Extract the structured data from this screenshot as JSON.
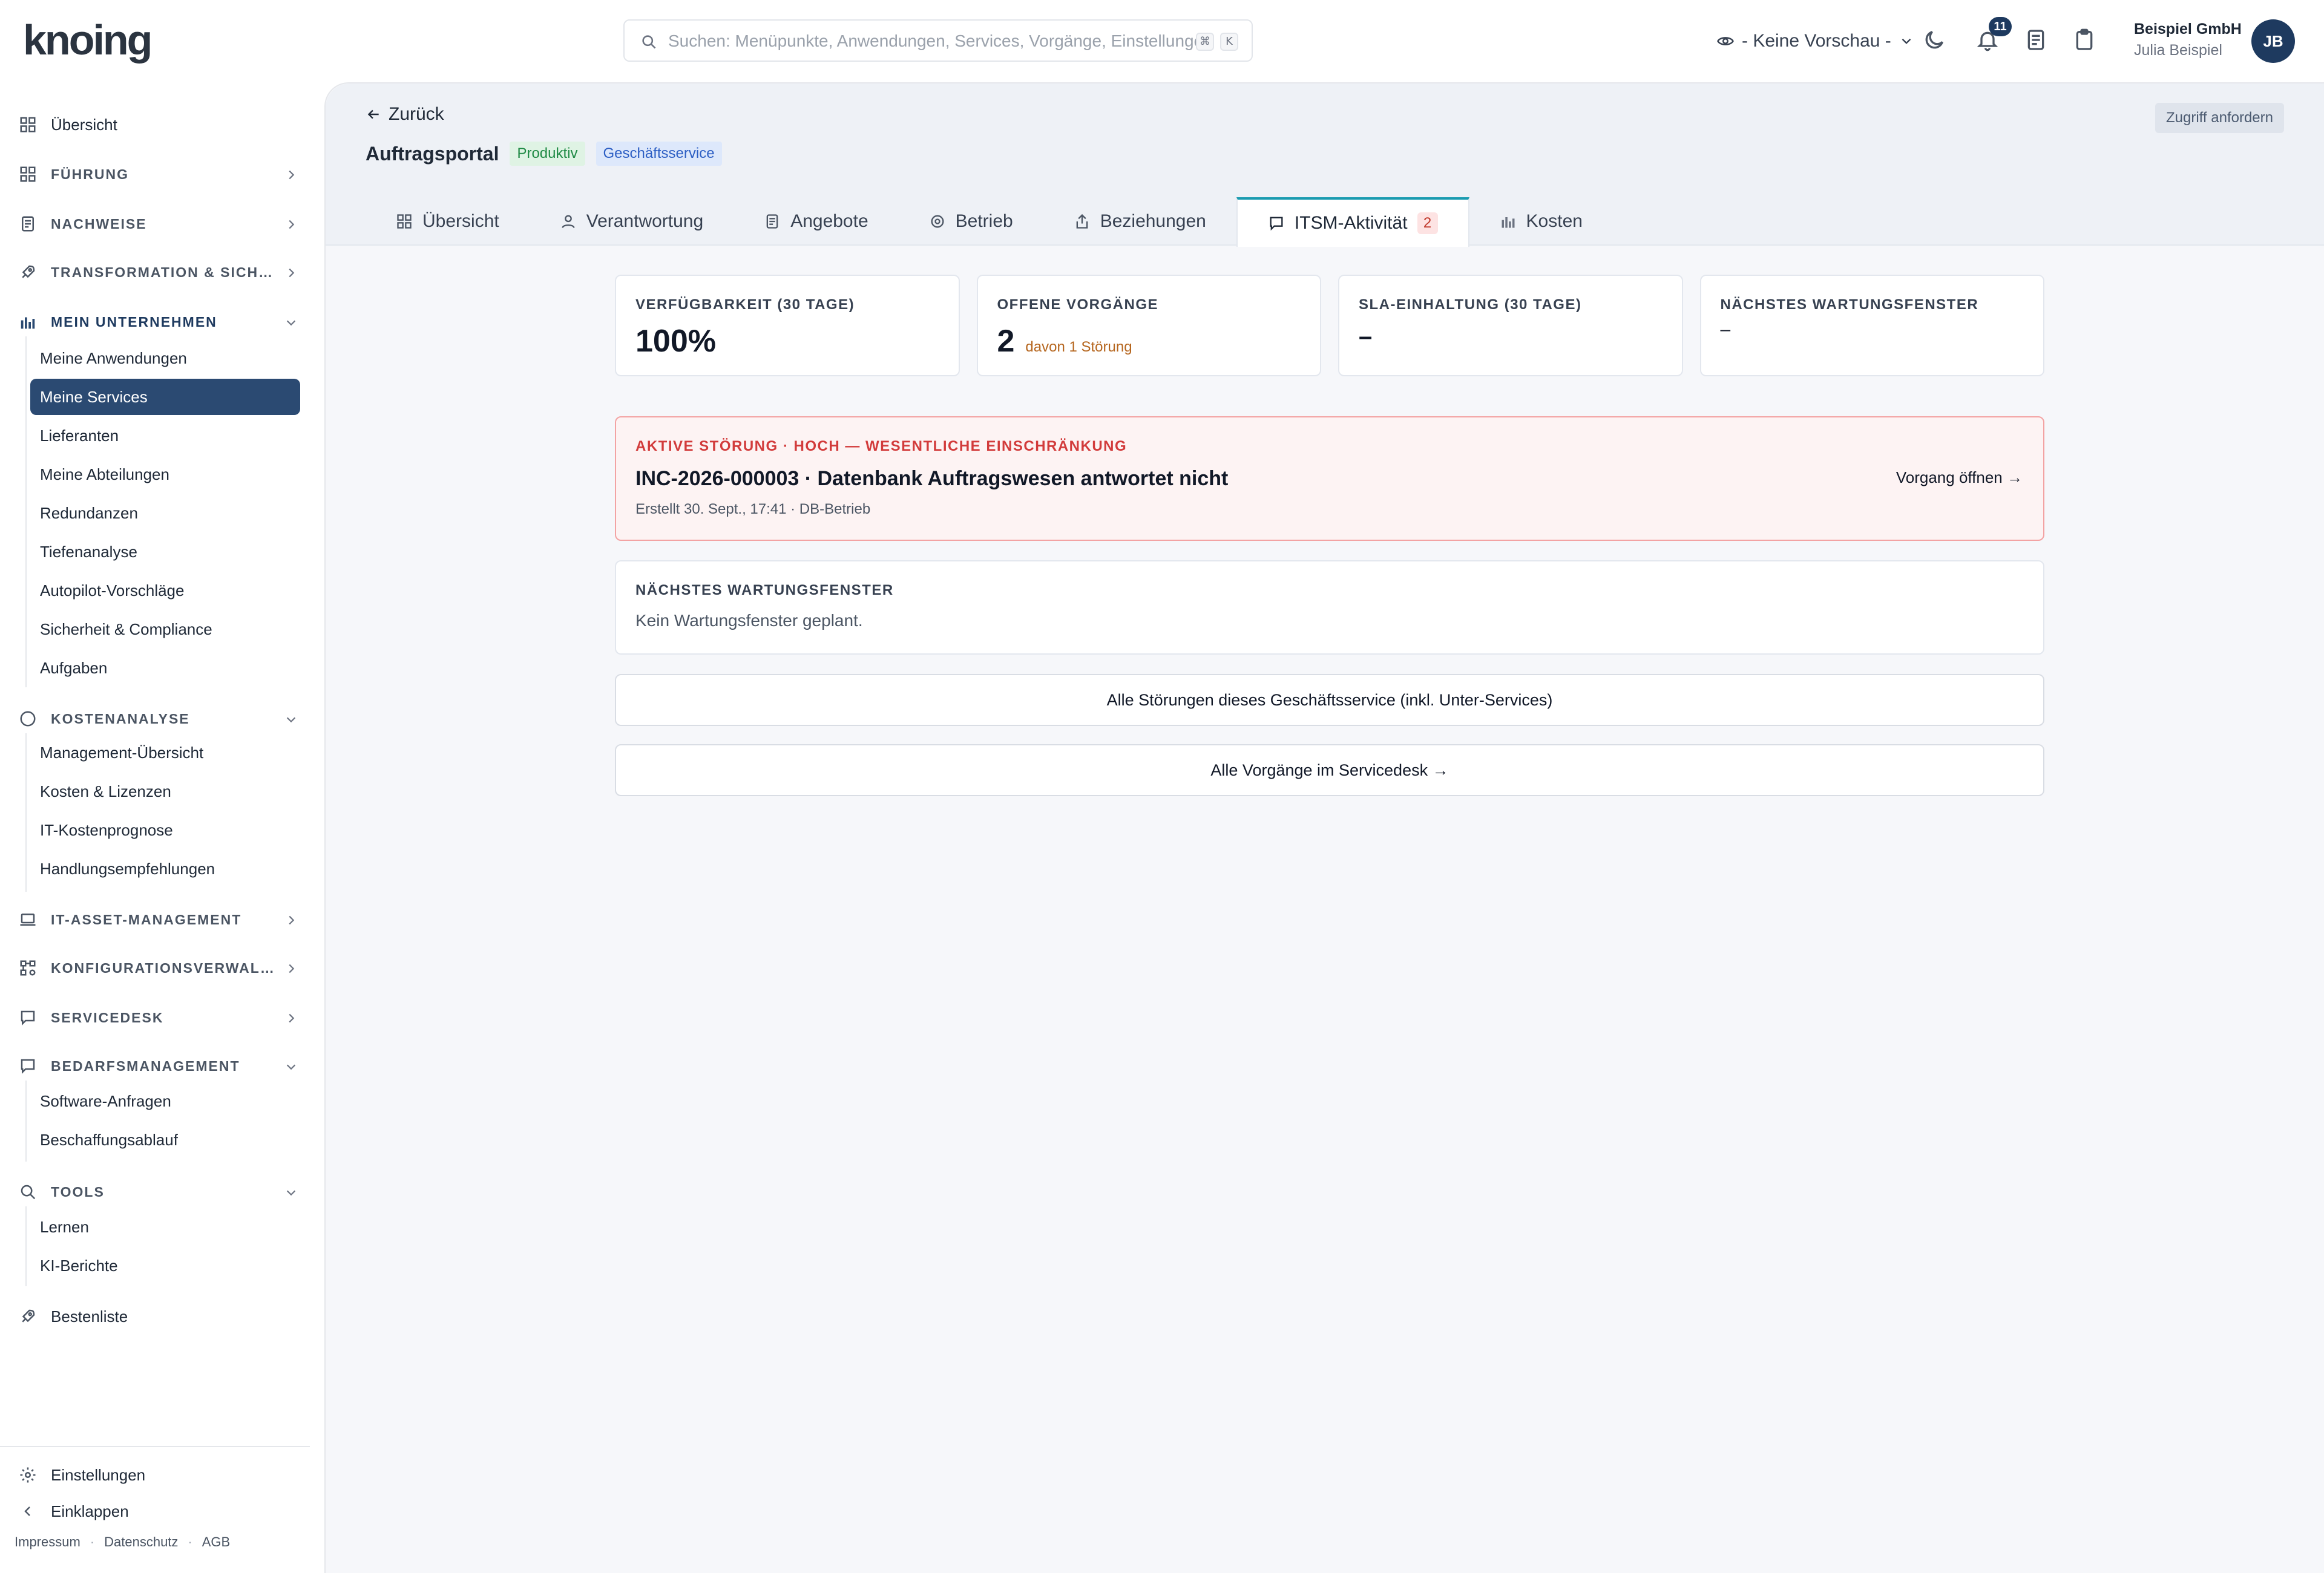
{
  "app": {
    "logo": "knoing",
    "search_placeholder": "Suchen: Menüpunkte, Anwendungen, Services, Vorgänge, Einstellungen",
    "shortcut_keys": [
      "⌘",
      "K"
    ],
    "preview_label": "- Keine Vorschau -",
    "notifications_count": "11",
    "org_name": "Beispiel GmbH",
    "user_name": "Julia Beispiel",
    "avatar_initials": "JB"
  },
  "sidebar": {
    "overview": "Übersicht",
    "sections": {
      "fuehrung": "Führung",
      "nachweise": "Nachweise",
      "transformation": "Transformation & Sich…",
      "mein_unternehmen": "Mein Unternehmen",
      "kostenanalyse": "Kostenanalyse",
      "itam": "IT-Asset-Management",
      "konfig": "Konfigurationsverwal…",
      "servicedesk": "Servicedesk",
      "bedarf": "Bedarfsmanagement",
      "tools": "Tools"
    },
    "mein_unternehmen_items": [
      "Meine Anwendungen",
      "Meine Services",
      "Lieferanten",
      "Meine Abteilungen",
      "Redundanzen",
      "Tiefenanalyse",
      "Autopilot-Vorschläge",
      "Sicherheit & Compliance",
      "Aufgaben"
    ],
    "kostenanalyse_items": [
      "Management-Übersicht",
      "Kosten & Lizenzen",
      "IT-Kostenprognose",
      "Handlungsempfehlungen"
    ],
    "bedarf_items": [
      "Software-Anfragen",
      "Beschaffungsablauf"
    ],
    "tools_items": [
      "Lernen",
      "KI-Berichte"
    ],
    "bestenliste": "Bestenliste",
    "einstellungen": "Einstellungen",
    "einklappen": "Einklappen",
    "footer": [
      "Impressum",
      "Datenschutz",
      "AGB"
    ]
  },
  "header": {
    "back": "Zurück",
    "access_button": "Zugriff anfordern",
    "title": "Auftragsportal",
    "badges": [
      "Produktiv",
      "Geschäftsservice"
    ],
    "tabs": [
      {
        "label": "Übersicht"
      },
      {
        "label": "Verantwortung"
      },
      {
        "label": "Angebote"
      },
      {
        "label": "Betrieb"
      },
      {
        "label": "Beziehungen"
      },
      {
        "label": "ITSM-Aktivität",
        "count": "2"
      },
      {
        "label": "Kosten"
      }
    ],
    "active_tab": "ITSM-Aktivität"
  },
  "kpis": [
    {
      "label": "Verfügbarkeit (30 Tage)",
      "value": "100%"
    },
    {
      "label": "Offene Vorgänge",
      "value": "2",
      "sub": "davon 1 Störung"
    },
    {
      "label": "SLA-Einhaltung (30 Tage)",
      "value": "–"
    },
    {
      "label": "Nächstes Wartungsfenster",
      "value": "–"
    }
  ],
  "incident": {
    "label": "AKTIVE STÖRUNG · HOCH — WESENTLICHE EINSCHRÄNKUNG",
    "headline": "INC-2026-000003 · Datenbank Auftragswesen antwortet nicht",
    "meta": "Erstellt 30. Sept., 17:41 · DB-Betrieb",
    "action": "Vorgang öffnen →"
  },
  "maintenance": {
    "label": "NÄCHSTES WARTUNGSFENSTER",
    "text": "Kein Wartungsfenster geplant."
  },
  "buttons": {
    "all_incidents": "Alle Störungen dieses Geschäftsservice (inkl. Unter-Services)",
    "all_cases": "Alle Vorgänge im Servicedesk →"
  },
  "colors": {
    "primary": "#2b4a72",
    "accent_tab": "#1a9bb0",
    "alert_text": "#d23b3b",
    "badge_green": "#1f8a45",
    "badge_blue": "#2d5fc4"
  }
}
